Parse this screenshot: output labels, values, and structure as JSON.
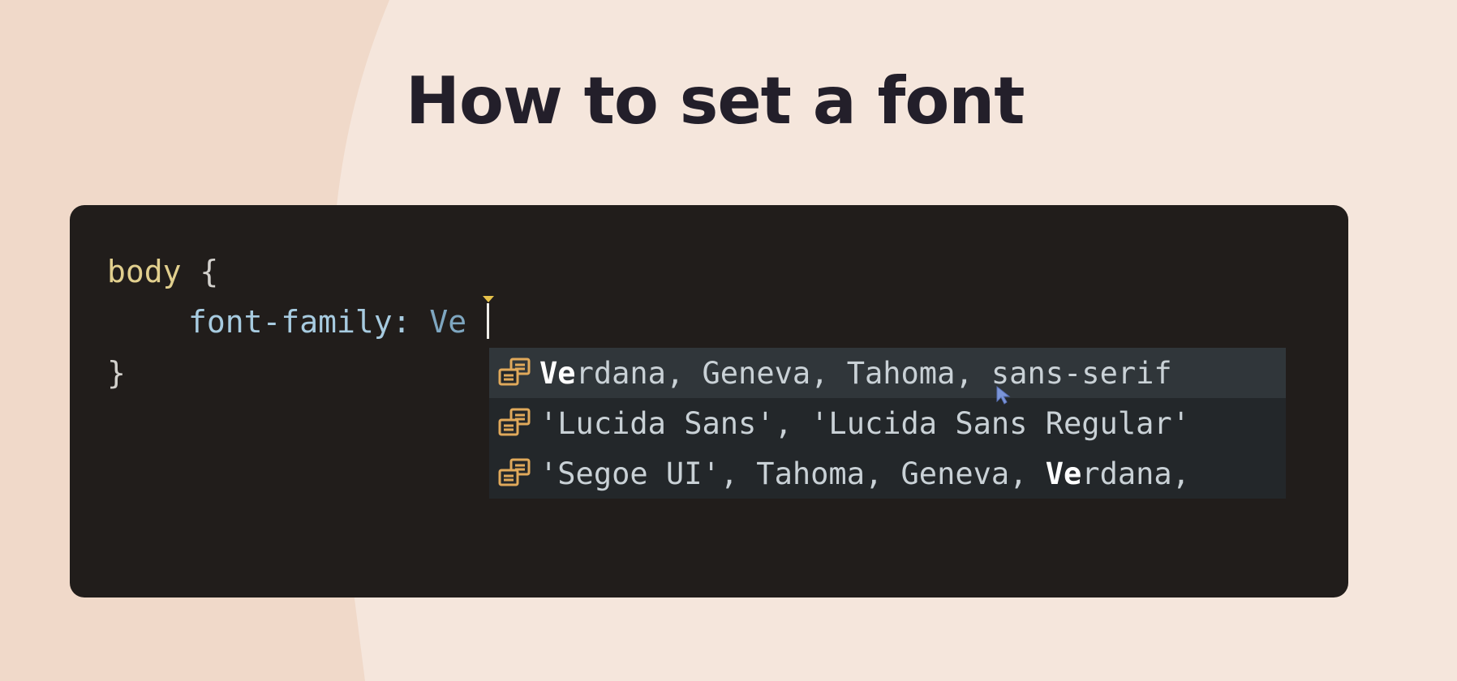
{
  "page": {
    "title": "How to set a font"
  },
  "colors": {
    "background": "#f5e6dc",
    "background_curve": "#f0d9c9",
    "editor_bg": "#211d1b",
    "selector": "#e1cf8e",
    "property": "#a7cbe0",
    "value": "#7ea6c0",
    "suggest_bg": "#23272a",
    "suggest_selected_bg": "#30363a",
    "icon": "#e0a95b"
  },
  "editor": {
    "line1": {
      "selector": "body",
      "brace_open": " {"
    },
    "line2": {
      "property": "font-family:",
      "value": " Ve"
    },
    "line3": {
      "brace_close": "}"
    }
  },
  "suggestions": [
    {
      "icon": "value-enum-icon",
      "match": "Ve",
      "rest": "rdana, Geneva, Tahoma, sans-serif",
      "selected": true
    },
    {
      "icon": "value-enum-icon",
      "text": "'Lucida Sans', 'Lucida Sans Regular'",
      "selected": false
    },
    {
      "icon": "value-enum-icon",
      "before": "'Segoe UI', Tahoma, Geneva, ",
      "match": "Ve",
      "rest": "rdana,",
      "selected": false
    }
  ]
}
